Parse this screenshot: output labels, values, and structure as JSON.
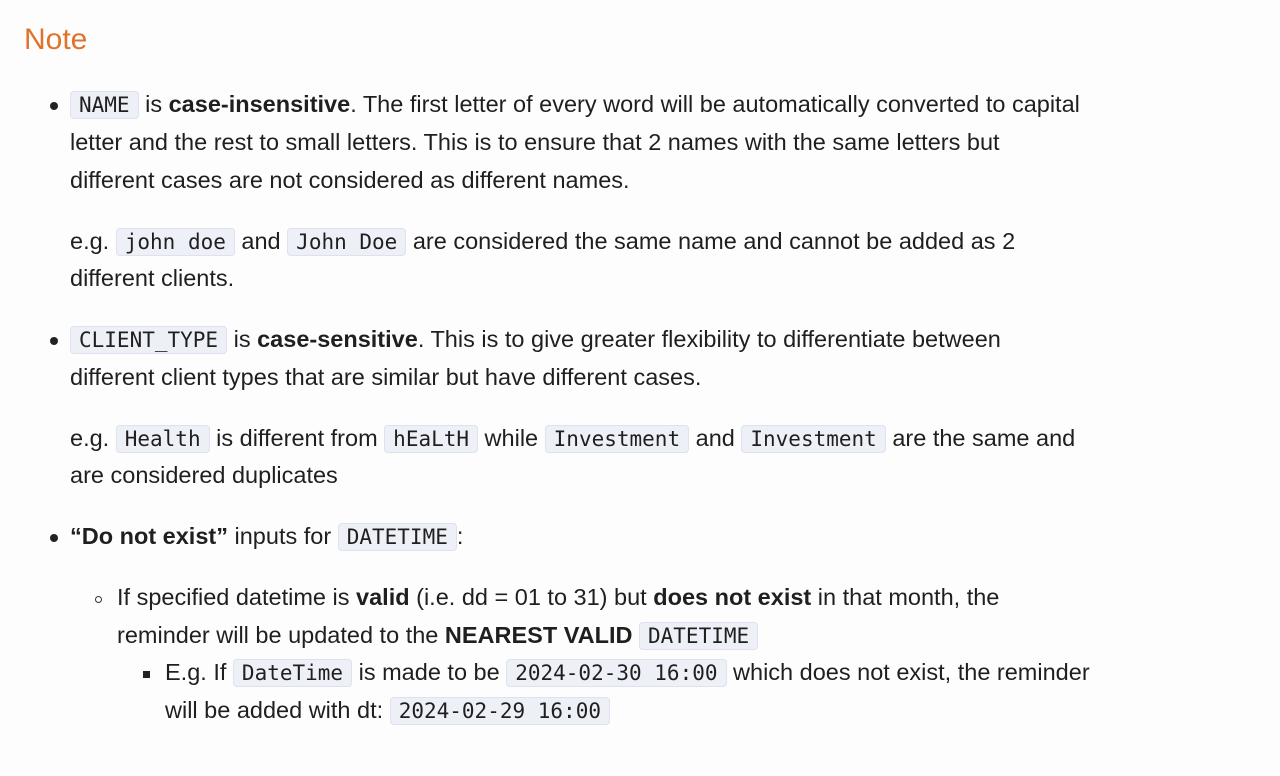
{
  "heading": "Note",
  "item1": {
    "code_name": "NAME",
    "text_is": " is ",
    "bold": "case-insensitive",
    "rest_line1": ". The first letter of every word will be automatically converted to capital",
    "line2": "letter and the rest to small letters. This is to ensure that 2 names with the same letters but",
    "line3": "different cases are not considered as different names.",
    "eg": {
      "prefix": "e.g. ",
      "code1": "john doe",
      "and": " and ",
      "code2": "John Doe",
      "rest_line1": " are considered the same name and cannot be added as 2",
      "line2": "different clients."
    }
  },
  "item2": {
    "code_name": "CLIENT_TYPE",
    "text_is": " is ",
    "bold": "case-sensitive",
    "rest_line1": ". This is to give greater flexibility to differentiate between",
    "line2": "different client types that are similar but have different cases.",
    "eg": {
      "prefix": "e.g. ",
      "code1": "Health",
      "mid1": " is different from ",
      "code2": "hEaLtH",
      "mid2": " while ",
      "code3": "Investment",
      "mid3": " and ",
      "code4": "Investment",
      "rest_line1": " are the same and",
      "line2": "are considered duplicates"
    }
  },
  "item3": {
    "bold": "“Do not exist”",
    "text": " inputs for ",
    "code": "DATETIME",
    "colon": ":",
    "sub": {
      "t1": "If specified datetime is ",
      "b1": "valid",
      "t2": " (i.e. dd = 01 to 31) but ",
      "b2": "does not exist",
      "t3": " in that month, the",
      "t4": "reminder will be updated to the ",
      "b3": "NEAREST VALID",
      "code": "DATETIME",
      "subsub": {
        "t1": "E.g. If ",
        "code1": "DateTime",
        "t2": " is made to be ",
        "code2": "2024-02-30 16:00",
        "t3": " which does not exist, the reminder",
        "t4": "will be added with dt: ",
        "code3": "2024-02-29 16:00"
      }
    }
  }
}
